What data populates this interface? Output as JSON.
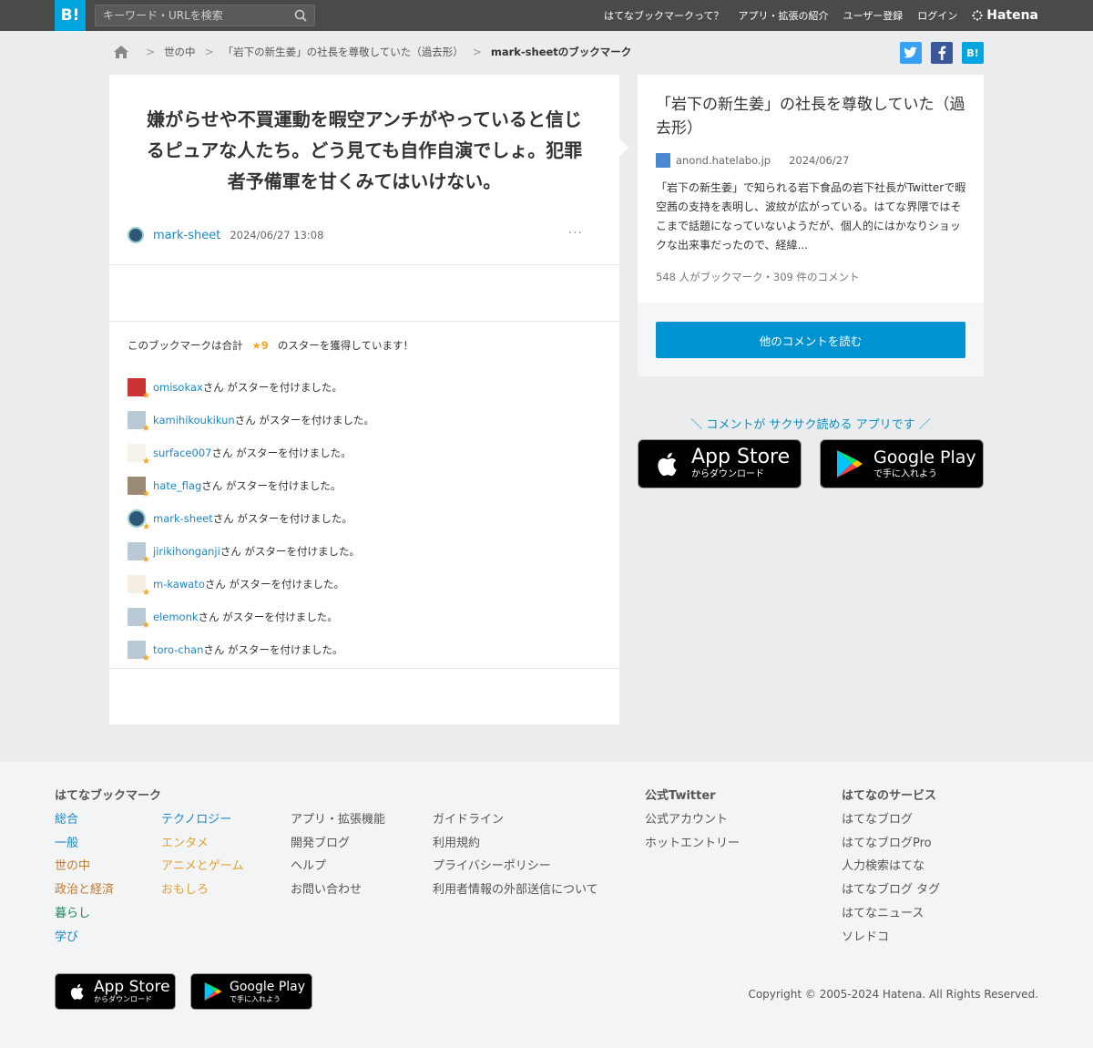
{
  "header": {
    "logo": "B!",
    "search_placeholder": "キーワード・URLを検索",
    "nav": [
      "はてなブックマークって？",
      "アプリ・拡張の紹介",
      "ユーザー登録",
      "ログイン"
    ],
    "brand": "Hatena"
  },
  "breadcrumb": {
    "items": [
      "世の中",
      "「岩下の新生姜」の社長を尊敬していた（過去形）"
    ],
    "current": "mark-sheetのブックマーク"
  },
  "share": {
    "twitter": "t",
    "facebook": "f",
    "hatena": "B!"
  },
  "comment": {
    "text": "嫌がらせや不買運動を暇空アンチがやっていると信じるピュアな人たち。どう見ても自作自演でしょ。犯罪者予備軍を甘くみてはいけない。",
    "author": "mark-sheet",
    "date": "2024/06/27 13:08",
    "more": "···"
  },
  "stars": {
    "summary_before": "このブックマークは合計",
    "total": "★9",
    "summary_after": "のスターを獲得しています！",
    "suffix": "さん がスターを付けました。",
    "users": [
      {
        "name": "omisokax",
        "avatar": "red"
      },
      {
        "name": "kamihikoukikun",
        "avatar": "default"
      },
      {
        "name": "surface007",
        "avatar": "light"
      },
      {
        "name": "hate_flag",
        "avatar": "dog"
      },
      {
        "name": "mark-sheet",
        "avatar": "dark"
      },
      {
        "name": "jirikihonganji",
        "avatar": "default"
      },
      {
        "name": "m-kawato",
        "avatar": "cat"
      },
      {
        "name": "elemonk",
        "avatar": "default"
      },
      {
        "name": "toro-chan",
        "avatar": "default"
      }
    ]
  },
  "entry": {
    "title": "「岩下の新生姜」の社長を尊敬していた（過去形）",
    "domain": "anond.hatelabo.jp",
    "date": "2024/06/27",
    "summary": "「岩下の新生姜」で知られる岩下食品の岩下社長がTwitterで暇空茜の支持を表明し、波紋が広がっている。はてな界隈ではそこまで話題になっていないようだが、個人的にはかなりショックな出来事だったので、経緯...",
    "counts": "548 人がブックマーク・309 件のコメント",
    "read_more": "他のコメントを読む"
  },
  "app_promo": {
    "tagline": "＼ コメントが サクサク読める アプリです ／",
    "app_store_name": "App Store",
    "app_store_sub": "からダウンロード",
    "google_play_name": "Google Play",
    "google_play_sub": "で手に入れよう"
  },
  "footer": {
    "head_bookmark": "はてなブックマーク",
    "head_twitter": "公式Twitter",
    "head_services": "はてなのサービス",
    "col1": [
      "総合",
      "一般",
      "世の中",
      "政治と経済",
      "暮らし",
      "学び"
    ],
    "col2": [
      "テクノロジー",
      "エンタメ",
      "アニメとゲーム",
      "おもしろ"
    ],
    "col3": [
      "アプリ・拡張機能",
      "開発ブログ",
      "ヘルプ",
      "お問い合わせ"
    ],
    "col4": [
      "ガイドライン",
      "利用規約",
      "プライバシーポリシー",
      "利用者情報の外部送信について"
    ],
    "twitter": [
      "公式アカウント",
      "ホットエントリー"
    ],
    "services": [
      "はてなブログ",
      "はてなブログPro",
      "人力検索はてな",
      "はてなブログ タグ",
      "はてなニュース",
      "ソレドコ"
    ],
    "copyright": "Copyright © 2005-2024 Hatena. All Rights Reserved."
  }
}
